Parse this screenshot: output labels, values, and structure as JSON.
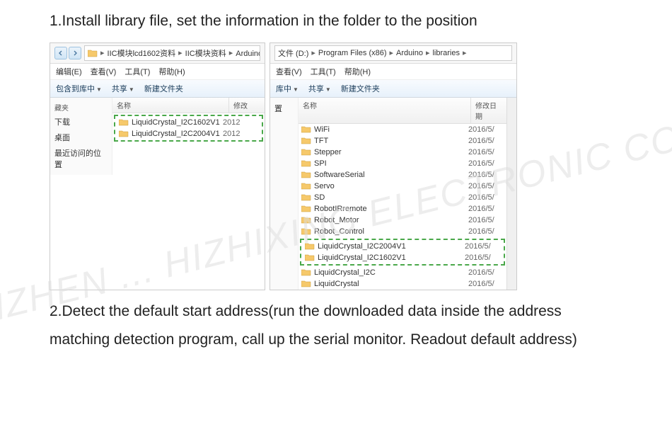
{
  "watermark": "SHENZHEN ... HIZHIXING ELECTRONIC CO.,LTD",
  "instr1": "1.Install library file, set the information in the folder to the position",
  "instr2": "2.Detect the default start address(run the downloaded data inside the address matching detection program, call up the serial monitor. Readout default address)",
  "left_window": {
    "breadcrumb_parts": [
      "IIC模块lcd1602资料",
      "IIC模块资料",
      "Arduino测试程序"
    ],
    "menu": {
      "edit": "编辑(E)",
      "view": "查看(V)",
      "tools": "工具(T)",
      "help": "帮助(H)"
    },
    "toolbar": {
      "include": "包含到库中",
      "share": "共享",
      "newfolder": "新建文件夹"
    },
    "sidebar": {
      "header": "藏夹",
      "items": [
        "下载",
        "桌面",
        "最近访问的位置"
      ]
    },
    "columns": {
      "name": "名称",
      "modified": "修改"
    },
    "files": [
      {
        "name": "LiquidCrystal_I2C1602V1",
        "date": "2012"
      },
      {
        "name": "LiquidCrystal_I2C2004V1",
        "date": "2012"
      }
    ]
  },
  "right_window": {
    "breadcrumb_prefix": "文件 (D:)",
    "breadcrumb_parts": [
      "Program Files (x86)",
      "Arduino",
      "libraries"
    ],
    "menu": {
      "view": "查看(V)",
      "tools": "工具(T)",
      "help": "帮助(H)"
    },
    "toolbar": {
      "include": "库中",
      "share": "共享",
      "newfolder": "新建文件夹"
    },
    "columns": {
      "name": "名称",
      "modified": "修改日期"
    },
    "sidebar_item": "置",
    "files_before": [
      {
        "name": "WiFi",
        "date": "2016/5/"
      },
      {
        "name": "TFT",
        "date": "2016/5/"
      },
      {
        "name": "Stepper",
        "date": "2016/5/"
      },
      {
        "name": "SPI",
        "date": "2016/5/"
      },
      {
        "name": "SoftwareSerial",
        "date": "2016/5/"
      },
      {
        "name": "Servo",
        "date": "2016/5/"
      },
      {
        "name": "SD",
        "date": "2016/5/"
      },
      {
        "name": "RobotIRremote",
        "date": "2016/5/"
      },
      {
        "name": "Robot_Motor",
        "date": "2016/5/"
      },
      {
        "name": "Robot_Control",
        "date": "2016/5/"
      }
    ],
    "files_highlight": [
      {
        "name": "LiquidCrystal_I2C2004V1",
        "date": "2016/5/"
      },
      {
        "name": "LiquidCrystal_I2C1602V1",
        "date": "2016/5/"
      }
    ],
    "files_after": [
      {
        "name": "LiquidCrystal_I2C",
        "date": "2016/5/"
      },
      {
        "name": "LiquidCrystal",
        "date": "2016/5/"
      }
    ]
  }
}
